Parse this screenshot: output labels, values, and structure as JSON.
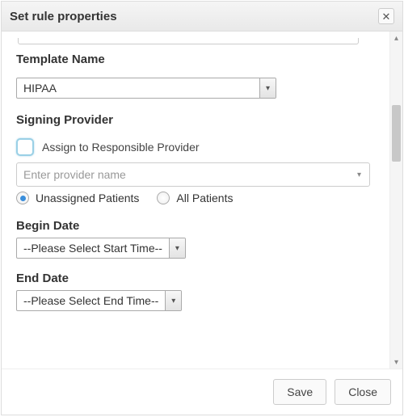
{
  "dialog": {
    "title": "Set rule properties"
  },
  "template": {
    "label": "Template Name",
    "selected": "HIPAA"
  },
  "signing": {
    "label": "Signing Provider",
    "assign_checkbox_label": "Assign to Responsible Provider",
    "assign_checked": false,
    "provider_placeholder": "Enter provider name",
    "scope_selected": "unassigned",
    "options": {
      "unassigned": "Unassigned Patients",
      "all": "All Patients"
    }
  },
  "dates": {
    "begin_label": "Begin Date",
    "begin_value": "--Please Select Start Time--",
    "end_label": "End Date",
    "end_value": "--Please Select End Time--"
  },
  "footer": {
    "save": "Save",
    "close": "Close"
  }
}
